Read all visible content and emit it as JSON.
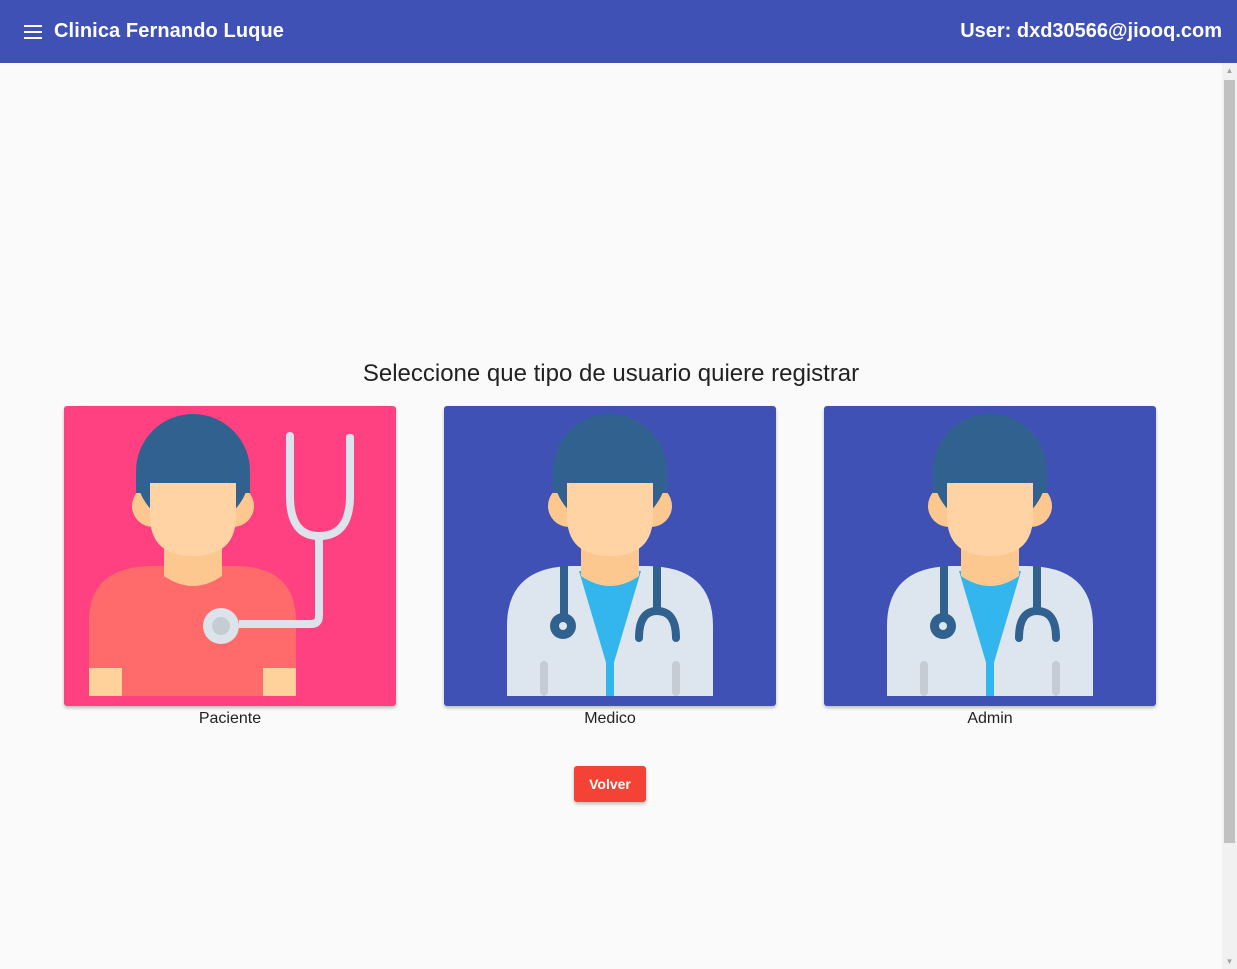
{
  "header": {
    "app_title": "Clinica Fernando Luque",
    "user_label": "User: dxd30566@jiooq.com",
    "background_color": "#3f51b5"
  },
  "main": {
    "heading": "Seleccione que tipo de usuario quiere registrar",
    "options": [
      {
        "label": "Paciente",
        "color": "#ff4081",
        "icon": "patient-icon"
      },
      {
        "label": "Medico",
        "color": "#3f51b5",
        "icon": "doctor-icon"
      },
      {
        "label": "Admin",
        "color": "#3f51b5",
        "icon": "doctor-icon"
      }
    ],
    "back_button": "Volver",
    "back_button_color": "#f44336"
  }
}
